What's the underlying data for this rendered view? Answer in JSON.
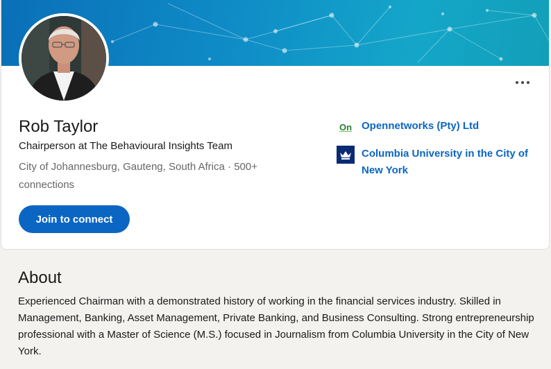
{
  "profile": {
    "name": "Rob Taylor",
    "headline": "Chairperson at The Behavioural Insights Team",
    "location": "City of Johannesburg, Gauteng, South Africa",
    "separator": "·",
    "connections": "500+ connections",
    "connect_label": "Join to connect",
    "more_label": "More actions"
  },
  "affiliations": [
    {
      "name": "Opennetworks (Pty) Ltd",
      "logo_text": "On",
      "logo_icon": "opennetworks-logo"
    },
    {
      "name": "Columbia University in the City of New York",
      "logo_icon": "columbia-crown-logo"
    }
  ],
  "about": {
    "title": "About",
    "text": "Experienced Chairman with a demonstrated history of working in the financial services industry. Skilled in Management, Banking, Asset Management, Private Banking, and Business Consulting. Strong entrepreneurship professional with a Master of Science (M.S.) focused in Journalism from Columbia University in the City of New York."
  },
  "colors": {
    "primary_blue": "#0a66c2",
    "banner_teal": "#14a6c9",
    "text_dark": "#191919",
    "text_muted": "#666666"
  }
}
